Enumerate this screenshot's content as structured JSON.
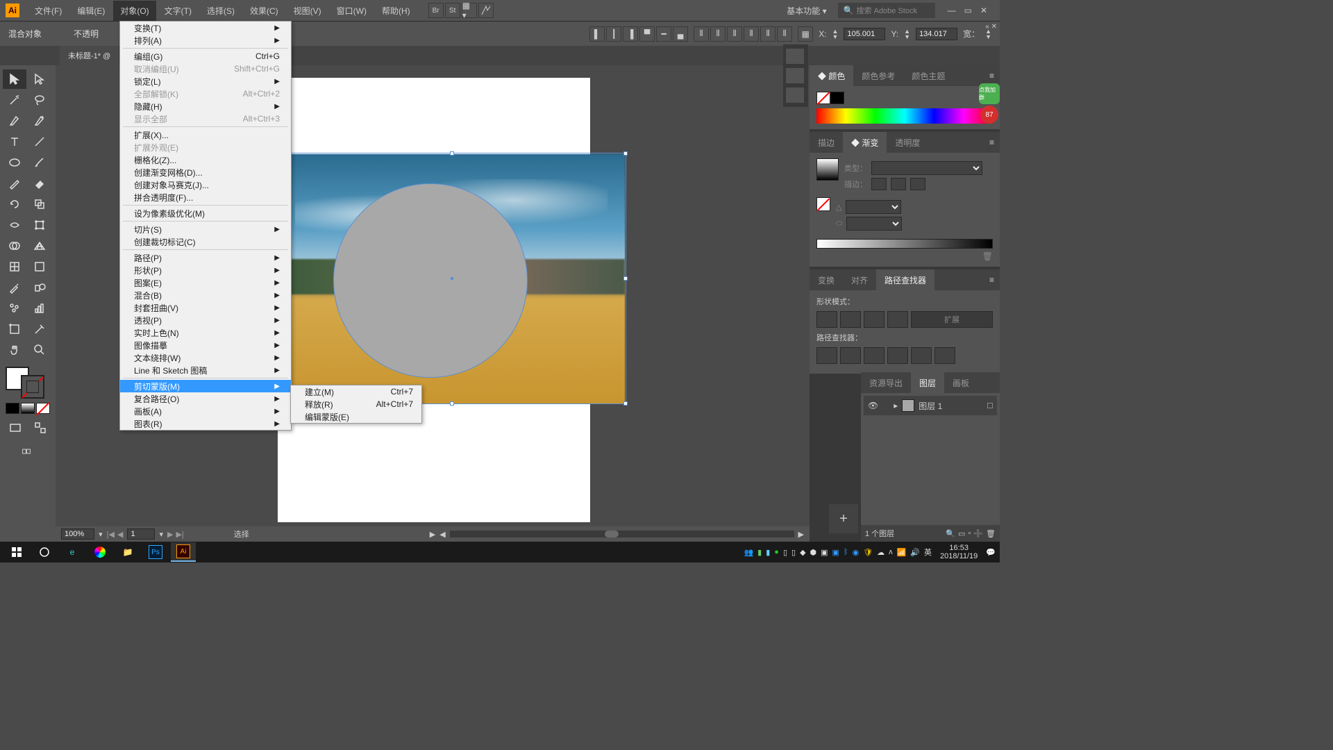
{
  "app": {
    "logo": "Ai"
  },
  "menubar": {
    "items": [
      "文件(F)",
      "编辑(E)",
      "对象(O)",
      "文字(T)",
      "选择(S)",
      "效果(C)",
      "视图(V)",
      "窗口(W)",
      "帮助(H)"
    ],
    "active_index": 2,
    "workspace": "基本功能",
    "search_placeholder": "搜索 Adobe Stock"
  },
  "optionsbar": {
    "label1": "混合对象",
    "label2": "不透明",
    "x_label": "X:",
    "x_value": "105.001",
    "y_label": "Y:",
    "y_value": "134.017",
    "w_label": "宽："
  },
  "doctab": "未标题-1* @",
  "menu_object": [
    {
      "t": "item",
      "label": "变换(T)",
      "sub": true
    },
    {
      "t": "item",
      "label": "排列(A)",
      "sub": true
    },
    {
      "t": "sep"
    },
    {
      "t": "item",
      "label": "编组(G)",
      "sc": "Ctrl+G"
    },
    {
      "t": "item",
      "label": "取消编组(U)",
      "sc": "Shift+Ctrl+G",
      "d": true
    },
    {
      "t": "item",
      "label": "锁定(L)",
      "sub": true
    },
    {
      "t": "item",
      "label": "全部解锁(K)",
      "sc": "Alt+Ctrl+2",
      "d": true
    },
    {
      "t": "item",
      "label": "隐藏(H)",
      "sub": true
    },
    {
      "t": "item",
      "label": "显示全部",
      "sc": "Alt+Ctrl+3",
      "d": true
    },
    {
      "t": "sep"
    },
    {
      "t": "item",
      "label": "扩展(X)..."
    },
    {
      "t": "item",
      "label": "扩展外观(E)",
      "d": true
    },
    {
      "t": "item",
      "label": "栅格化(Z)..."
    },
    {
      "t": "item",
      "label": "创建渐变网格(D)..."
    },
    {
      "t": "item",
      "label": "创建对象马赛克(J)..."
    },
    {
      "t": "item",
      "label": "拼合透明度(F)..."
    },
    {
      "t": "sep"
    },
    {
      "t": "item",
      "label": "设为像素级优化(M)"
    },
    {
      "t": "sep"
    },
    {
      "t": "item",
      "label": "切片(S)",
      "sub": true
    },
    {
      "t": "item",
      "label": "创建裁切标记(C)"
    },
    {
      "t": "sep"
    },
    {
      "t": "item",
      "label": "路径(P)",
      "sub": true
    },
    {
      "t": "item",
      "label": "形状(P)",
      "sub": true
    },
    {
      "t": "item",
      "label": "图案(E)",
      "sub": true
    },
    {
      "t": "item",
      "label": "混合(B)",
      "sub": true
    },
    {
      "t": "item",
      "label": "封套扭曲(V)",
      "sub": true
    },
    {
      "t": "item",
      "label": "透视(P)",
      "sub": true
    },
    {
      "t": "item",
      "label": "实时上色(N)",
      "sub": true
    },
    {
      "t": "item",
      "label": "图像描摹",
      "sub": true
    },
    {
      "t": "item",
      "label": "文本绕排(W)",
      "sub": true
    },
    {
      "t": "item",
      "label": "Line 和 Sketch 图稿",
      "sub": true
    },
    {
      "t": "sep"
    },
    {
      "t": "item",
      "label": "剪切蒙版(M)",
      "sub": true,
      "hover": true
    },
    {
      "t": "item",
      "label": "复合路径(O)",
      "sub": true
    },
    {
      "t": "item",
      "label": "画板(A)",
      "sub": true
    },
    {
      "t": "item",
      "label": "图表(R)",
      "sub": true
    }
  ],
  "submenu_clip": [
    {
      "label": "建立(M)",
      "sc": "Ctrl+7"
    },
    {
      "label": "释放(R)",
      "sc": "Alt+Ctrl+7",
      "d": true
    },
    {
      "label": "编辑蒙版(E)",
      "d": true
    }
  ],
  "statusbar": {
    "zoom": "100%",
    "page": "1",
    "tool": "选择"
  },
  "panels": {
    "color": {
      "tabs": [
        "颜色",
        "颜色参考",
        "颜色主题"
      ],
      "active": 0
    },
    "gradient": {
      "tabs": [
        "描边",
        "渐变",
        "透明度"
      ],
      "active": 1,
      "type_label": "类型：",
      "stroke_label": "描边："
    },
    "align": {
      "tabs": [
        "变换",
        "对齐",
        "路径查找器"
      ],
      "active": 2,
      "shape_mode": "形状模式：",
      "pathfind": "路径查找器：",
      "expand": "扩展"
    },
    "layers": {
      "tabs": [
        "资源导出",
        "图层",
        "画板"
      ],
      "active": 1,
      "layer_name": "图层 1",
      "footer": "1 个图层"
    }
  },
  "taskbar": {
    "tray_lang": "英",
    "clock_time": "16:53",
    "clock_date": "2018/11/19"
  },
  "badge": {
    "top": "点我加群",
    "num": "87"
  }
}
